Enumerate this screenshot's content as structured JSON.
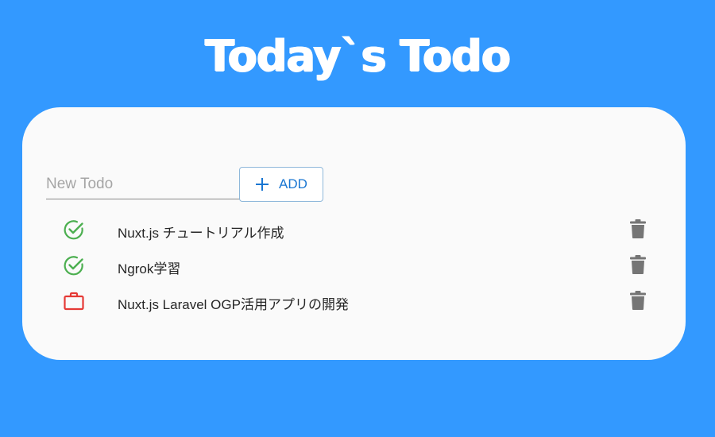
{
  "header": {
    "title": "Today`s Todo"
  },
  "new_todo": {
    "placeholder": "New Todo",
    "value": "",
    "add_label": "ADD",
    "add_icon": "plus-icon"
  },
  "todos": [
    {
      "text": "Nuxt.js チュートリアル作成",
      "status": "done",
      "icon": "check-circle-icon"
    },
    {
      "text": "Ngrok学習",
      "status": "done",
      "icon": "check-circle-icon"
    },
    {
      "text": "Nuxt.js Laravel OGP活用アプリの開発",
      "status": "in-progress",
      "icon": "briefcase-icon"
    }
  ],
  "colors": {
    "background": "#3399ff",
    "card": "#fafafa",
    "done": "#4caf50",
    "in_progress": "#e53935",
    "accent": "#1976d2",
    "delete": "#757575"
  }
}
